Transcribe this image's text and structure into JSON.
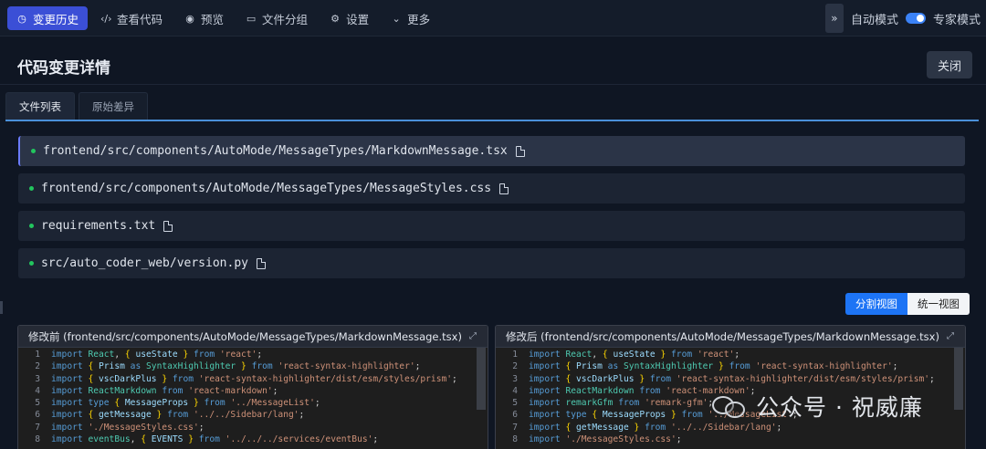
{
  "topbar": {
    "nav": [
      {
        "icon": "clock-icon",
        "glyph": "◷",
        "label": "变更历史",
        "active": true
      },
      {
        "icon": "code-icon",
        "glyph": "‹/›",
        "label": "查看代码"
      },
      {
        "icon": "eye-icon",
        "glyph": "◉",
        "label": "预览"
      },
      {
        "icon": "folder-icon",
        "glyph": "▭",
        "label": "文件分组"
      },
      {
        "icon": "gear-icon",
        "glyph": "⚙",
        "label": "设置"
      },
      {
        "icon": "chevron-down-icon",
        "glyph": "⌄",
        "label": "更多"
      }
    ],
    "collapse_glyph": "»",
    "auto_mode": "自动模式",
    "expert_mode": "专家模式"
  },
  "header": {
    "title": "代码变更详情",
    "close": "关闭"
  },
  "tabs": [
    {
      "label": "文件列表",
      "active": true
    },
    {
      "label": "原始差异"
    }
  ],
  "files": [
    "frontend/src/components/AutoMode/MessageTypes/MarkdownMessage.tsx",
    "frontend/src/components/AutoMode/MessageTypes/MessageStyles.css",
    "requirements.txt",
    "src/auto_coder_web/version.py"
  ],
  "view_toggle": {
    "split": "分割视图",
    "unified": "统一视图"
  },
  "diff": {
    "before_title": "修改前 (frontend/src/components/AutoMode/MessageTypes/MarkdownMessage.tsx)",
    "after_title": "修改后 (frontend/src/components/AutoMode/MessageTypes/MarkdownMessage.tsx)",
    "before_lines": [
      "import React, { useState } from 'react';",
      "import { Prism as SyntaxHighlighter } from 'react-syntax-highlighter';",
      "import { vscDarkPlus } from 'react-syntax-highlighter/dist/esm/styles/prism';",
      "import ReactMarkdown from 'react-markdown';",
      "import type { MessageProps } from '../MessageList';",
      "import { getMessage } from '../../Sidebar/lang';",
      "import './MessageStyles.css';",
      "import eventBus, { EVENTS } from '../../../services/eventBus';"
    ],
    "after_lines": [
      "import React, { useState } from 'react';",
      "import { Prism as SyntaxHighlighter } from 'react-syntax-highlighter';",
      "import { vscDarkPlus } from 'react-syntax-highlighter/dist/esm/styles/prism';",
      "import ReactMarkdown from 'react-markdown';",
      "import remarkGfm from 'remark-gfm';",
      "import type { MessageProps } from '../MessageList';",
      "import { getMessage } from '../../Sidebar/lang';",
      "import './MessageStyles.css';"
    ]
  },
  "watermark": {
    "text": "公众号 · 祝威廉"
  }
}
